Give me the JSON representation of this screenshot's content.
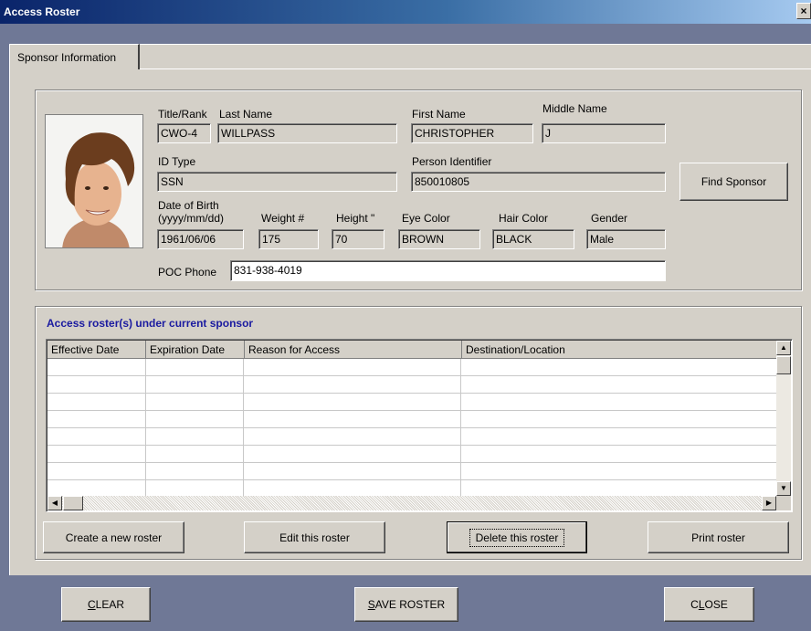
{
  "window": {
    "title": "Access Roster",
    "close_glyph": "×"
  },
  "tabs": [
    {
      "label": "Sponsor Information"
    }
  ],
  "sponsor": {
    "labels": {
      "title_rank": "Title/Rank",
      "last_name": "Last Name",
      "first_name": "First Name",
      "middle_name": "Middle Name",
      "id_type": "ID Type",
      "person_identifier": "Person Identifier",
      "dob_line1": "Date of Birth",
      "dob_line2": "(yyyy/mm/dd)",
      "weight": "Weight #",
      "height": "Height \"",
      "eye_color": "Eye Color",
      "hair_color": "Hair Color",
      "gender": "Gender",
      "poc_phone": "POC Phone"
    },
    "values": {
      "title_rank": "CWO-4",
      "last_name": "WILLPASS",
      "first_name": "CHRISTOPHER",
      "middle_name": "J",
      "id_type": "SSN",
      "person_identifier": "850010805",
      "dob": "1961/06/06",
      "weight": "175",
      "height": "70",
      "eye_color": "BROWN",
      "hair_color": "BLACK",
      "gender": "Male",
      "poc_phone": "831-938-4019"
    },
    "find_button": "Find Sponsor"
  },
  "roster": {
    "section_title": "Access roster(s) under current sponsor",
    "columns": [
      "Effective Date",
      "Expiration Date",
      "Reason for Access",
      "Destination/Location"
    ],
    "buttons": {
      "create": "Create a new roster",
      "edit": "Edit this roster",
      "delete": "Delete this roster",
      "print": "Print roster"
    }
  },
  "footer": {
    "clear": {
      "mnemonic": "C",
      "rest": "LEAR"
    },
    "save": {
      "mnemonic": "S",
      "rest": "AVE ROSTER"
    },
    "close": {
      "pre": "C",
      "mnemonic": "L",
      "rest": "OSE"
    }
  },
  "colors": {
    "section_title": "#1a1aa0",
    "form_bg": "#d4d0c8",
    "desktop": "#6f7896"
  }
}
